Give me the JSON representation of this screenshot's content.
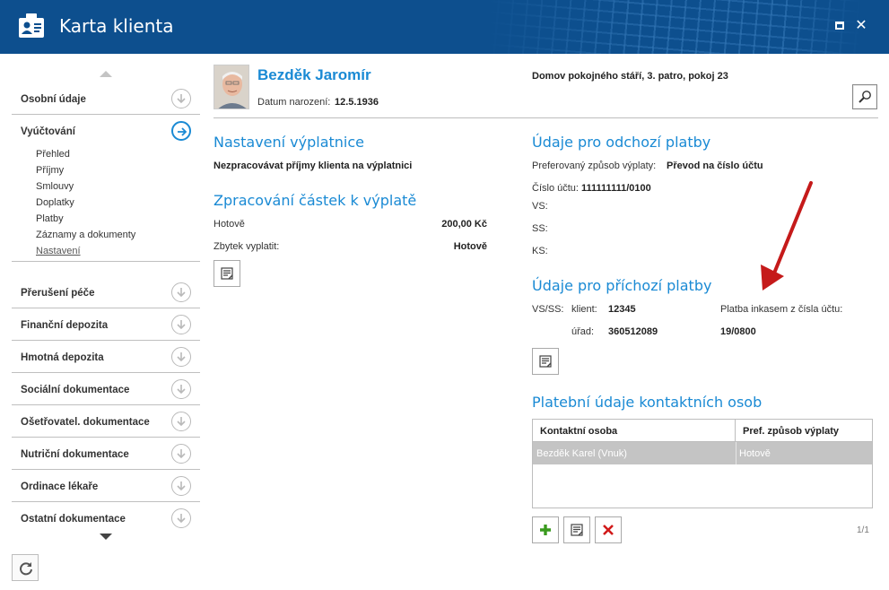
{
  "window": {
    "title": "Karta klienta"
  },
  "sidebar": {
    "items": [
      {
        "label": "Osobní údaje",
        "state": "collapsed"
      },
      {
        "label": "Vyúčtování",
        "state": "expanded"
      },
      {
        "label": "Přerušení péče",
        "state": "collapsed"
      },
      {
        "label": "Finanční depozita",
        "state": "collapsed"
      },
      {
        "label": "Hmotná depozita",
        "state": "collapsed"
      },
      {
        "label": "Sociální dokumentace",
        "state": "collapsed"
      },
      {
        "label": "Ošetřovatel. dokumentace",
        "state": "collapsed"
      },
      {
        "label": "Nutriční dokumentace",
        "state": "collapsed"
      },
      {
        "label": "Ordinace lékaře",
        "state": "collapsed"
      },
      {
        "label": "Ostatní dokumentace",
        "state": "collapsed"
      }
    ],
    "subitems": [
      "Přehled",
      "Příjmy",
      "Smlouvy",
      "Doplatky",
      "Platby",
      "Záznamy a dokumenty",
      "Nastavení"
    ],
    "current_subitem": "Nastavení"
  },
  "client": {
    "name": "Bezděk Jaromír",
    "dob_label": "Datum narození:",
    "dob": "12.5.1936",
    "address": "Domov pokojného stáří, 3. patro, pokoj 23"
  },
  "payout_settings": {
    "title": "Nastavení výplatnice",
    "note": "Nezpracovávat příjmy klienta na výplatnici"
  },
  "processing": {
    "title": "Zpracování částek k výplatě",
    "rows": [
      {
        "label": "Hotově",
        "value": "200,00 Kč"
      },
      {
        "label": "Zbytek vyplatit:",
        "value": "Hotově"
      }
    ]
  },
  "outgoing": {
    "title": "Údaje pro odchozí platby",
    "method_label": "Preferovaný způsob výplaty:",
    "method_value": "Převod na číslo účtu",
    "account_label": "Číslo účtu:",
    "account_value": "111111111/0100",
    "vs_label": "VS:",
    "ss_label": "SS:",
    "ks_label": "KS:"
  },
  "incoming": {
    "title": "Údaje pro příchozí platby",
    "vsss_label": "VS/SS:",
    "client_label": "klient:",
    "client_value": "12345",
    "office_label": "úřad:",
    "office_value": "360512089",
    "collection_label": "Platba inkasem z čísla účtu:",
    "collection_value": "19/0800"
  },
  "contacts": {
    "title": "Platební údaje kontaktních osob",
    "columns": [
      "Kontaktní osoba",
      "Pref. způsob výplaty"
    ],
    "rows": [
      [
        "Bezděk Karel (Vnuk)",
        "Hotově"
      ]
    ],
    "pager": "1/1"
  },
  "colors": {
    "titlebar": "#0d4f8e",
    "accent": "#1a8ad4",
    "selected_row": "#c4c4c4",
    "add_green": "#3a9a1e",
    "delete_red": "#d11a1a",
    "annotation_arrow": "#c51a1a"
  },
  "icons": {
    "app": "client-card-icon",
    "maximize": "maximize-icon",
    "close": "close-icon",
    "search": "magnifier-icon",
    "edit": "edit-note-icon",
    "add": "plus-icon",
    "delete": "x-icon",
    "refresh": "refresh-icon",
    "collapsed": "chevron-down-circle-icon",
    "expanded": "arrow-right-circle-icon"
  }
}
